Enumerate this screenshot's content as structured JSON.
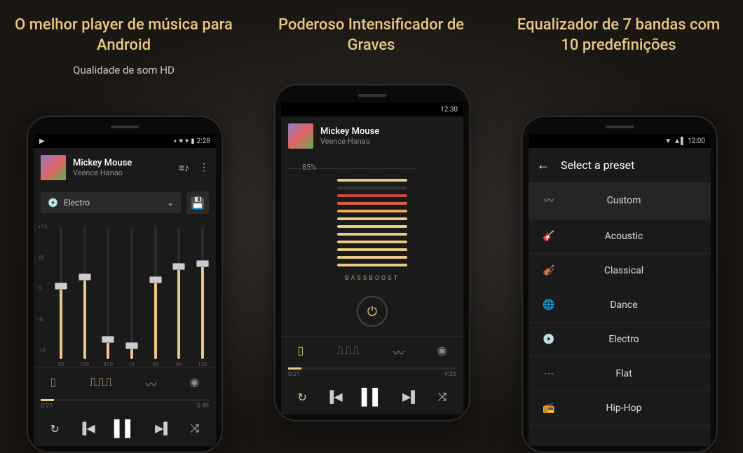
{
  "pane1": {
    "title": "O melhor player de música para Android",
    "subtitle": "Qualidade de som HD",
    "statusbar_time": "2:28",
    "track": {
      "title": "Mickey Mouse",
      "artist": "Veence Hanao"
    },
    "preset": "Electro",
    "eq": {
      "db_labels": [
        "+16",
        "+8",
        "0",
        "-8",
        "-16"
      ],
      "freqs": [
        "50",
        "150",
        "400",
        "1K",
        "3K",
        "6K",
        "12K"
      ],
      "values": [
        55,
        62,
        15,
        10,
        60,
        70,
        72
      ]
    },
    "progress": {
      "current": "0:21",
      "total": "5:49"
    }
  },
  "pane2": {
    "title": "Poderoso Intensificador de Graves",
    "statusbar_time": "12:30",
    "track": {
      "title": "Mickey Mouse",
      "artist": "Veence Hanao"
    },
    "bass_percent": "85%",
    "bass_bars": [
      "#e8c882",
      "#333",
      "#c9453d",
      "#d8653a",
      "#e8a956",
      "#e8c882",
      "#e8c882",
      "#e8c882",
      "#e8c882",
      "#e8c882",
      "#e8c882",
      "#e8c882"
    ],
    "bass_label": "BASSBOOST",
    "progress": {
      "current": "0:21",
      "total": "4:36"
    }
  },
  "pane3": {
    "title": "Equalizador de 7 bandas com 10 predefinições",
    "statusbar_time": "12:00",
    "header": "Select a preset",
    "presets": [
      {
        "icon": "〰",
        "label": "Custom",
        "selected": true
      },
      {
        "icon": "🎸",
        "label": "Acoustic"
      },
      {
        "icon": "🎻",
        "label": "Classical"
      },
      {
        "icon": "🌐",
        "label": "Dance"
      },
      {
        "icon": "💿",
        "label": "Electro"
      },
      {
        "icon": "⋯",
        "label": "Flat"
      },
      {
        "icon": "📻",
        "label": "Hip-Hop"
      }
    ]
  }
}
